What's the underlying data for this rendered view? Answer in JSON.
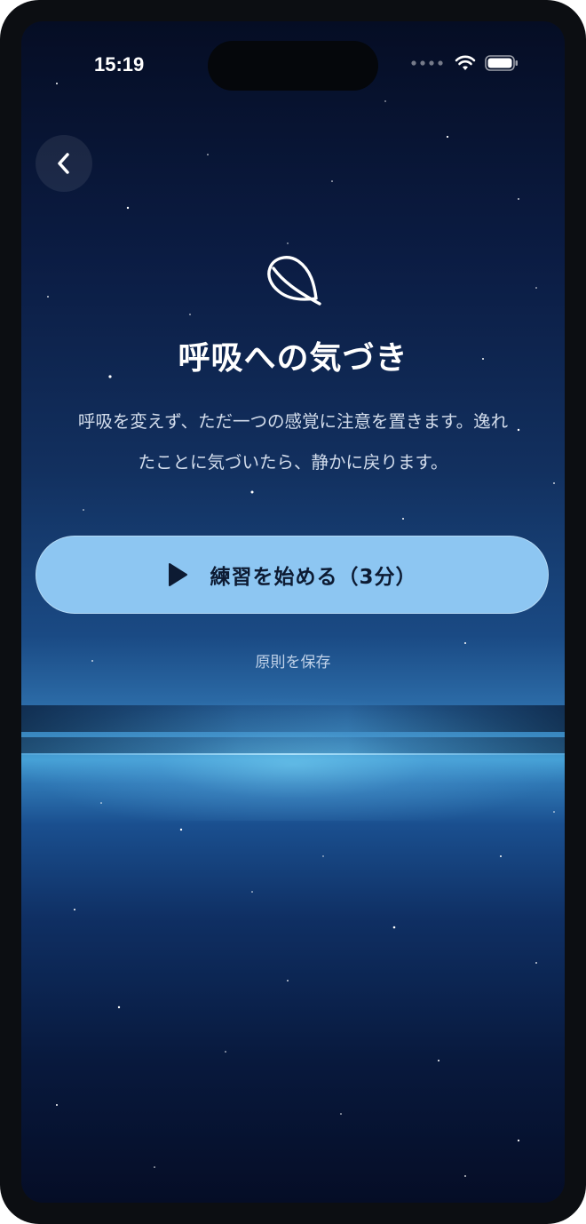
{
  "status_bar": {
    "time": "15:19",
    "icons": [
      "signal-dots-icon",
      "wifi-icon",
      "battery-icon"
    ]
  },
  "nav": {
    "back_icon": "chevron-left-icon"
  },
  "hero": {
    "icon": "leaf-icon",
    "title": "呼吸への気づき",
    "description_line1": "呼吸を変えず、ただ一つの感覚に注意を置きます。逸れ",
    "description_line2": "たことに気づいたら、静かに戻ります。"
  },
  "actions": {
    "start_label": "練習を始める（3分）",
    "start_icon": "play-icon",
    "save_label": "原則を保存"
  },
  "colors": {
    "accent": "#8dc6f2",
    "button_text": "#0d1b33",
    "background_top": "#050d24",
    "horizon_glow": "#46a1d6"
  }
}
